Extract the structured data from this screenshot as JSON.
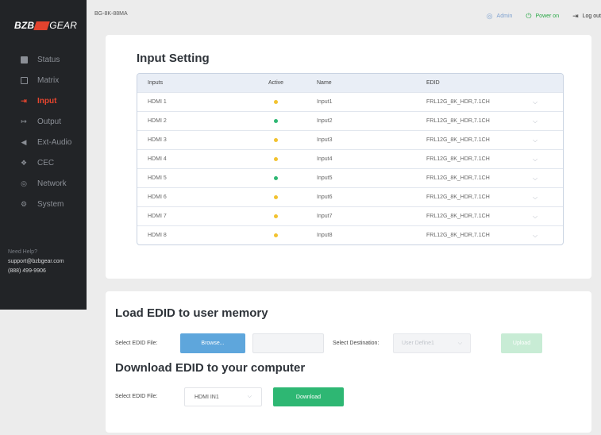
{
  "brand": {
    "part1": "BZB",
    "part2": "GEAR"
  },
  "device": {
    "model": "BG-8K-88MA"
  },
  "topbar": {
    "admin": {
      "label": "Admin",
      "icon": "user-circle-icon"
    },
    "power": {
      "label": "Power on",
      "icon": "power-icon"
    },
    "logout": {
      "label": "Log out",
      "icon": "logout-icon"
    }
  },
  "colors": {
    "accent": "#e6462f",
    "sidebar_bg": "#222427",
    "green": "#2eb773",
    "yellow": "#f2c230",
    "blue": "#5ea6dc"
  },
  "sidebar": {
    "items": [
      {
        "label": "Status",
        "icon": "status-icon"
      },
      {
        "label": "Matrix",
        "icon": "matrix-icon"
      },
      {
        "label": "Input",
        "icon": "input-icon",
        "active": true
      },
      {
        "label": "Output",
        "icon": "output-icon"
      },
      {
        "label": "Ext-Audio",
        "icon": "speaker-icon"
      },
      {
        "label": "CEC",
        "icon": "cec-icon"
      },
      {
        "label": "Network",
        "icon": "network-icon"
      },
      {
        "label": "System",
        "icon": "gear-icon"
      }
    ],
    "help": {
      "title": "Need Help?",
      "email": "support@bzbgear.com",
      "phone": "(888) 499-9906"
    }
  },
  "input_setting": {
    "title": "Input Setting",
    "columns": [
      "Inputs",
      "Active",
      "Name",
      "EDID"
    ],
    "rows": [
      {
        "input": "HDMI 1",
        "active": "yellow",
        "name": "Input1",
        "edid": "FRL12G_8K_HDR,7.1CH"
      },
      {
        "input": "HDMI 2",
        "active": "green",
        "name": "Input2",
        "edid": "FRL12G_8K_HDR,7.1CH"
      },
      {
        "input": "HDMI 3",
        "active": "yellow",
        "name": "Input3",
        "edid": "FRL12G_8K_HDR,7.1CH"
      },
      {
        "input": "HDMI 4",
        "active": "yellow",
        "name": "Input4",
        "edid": "FRL12G_8K_HDR,7.1CH"
      },
      {
        "input": "HDMI 5",
        "active": "green",
        "name": "Input5",
        "edid": "FRL12G_8K_HDR,7.1CH"
      },
      {
        "input": "HDMI 6",
        "active": "yellow",
        "name": "Input6",
        "edid": "FRL12G_8K_HDR,7.1CH"
      },
      {
        "input": "HDMI 7",
        "active": "yellow",
        "name": "Input7",
        "edid": "FRL12G_8K_HDR,7.1CH"
      },
      {
        "input": "HDMI 8",
        "active": "yellow",
        "name": "Input8",
        "edid": "FRL12G_8K_HDR,7.1CH"
      }
    ]
  },
  "load_edid": {
    "title": "Load EDID to user memory",
    "select_file_label": "Select EDID File:",
    "browse_label": "Browse...",
    "file_value": "",
    "select_destination_label": "Select Destination:",
    "destination_value": "User Define1",
    "upload_label": "Upload"
  },
  "download_edid": {
    "title": "Download EDID to your computer",
    "select_file_label": "Select EDID File:",
    "file_value": "HDMI IN1",
    "download_label": "Download"
  }
}
